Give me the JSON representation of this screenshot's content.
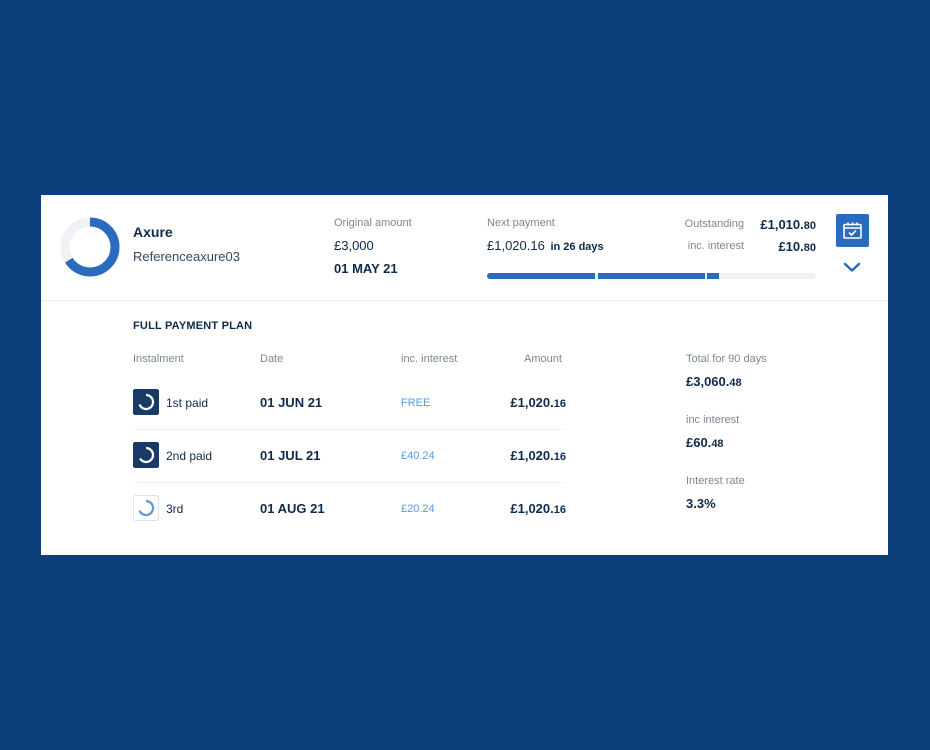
{
  "merchant": {
    "name": "Axure",
    "reference": "Referenceaxure03",
    "progress_fraction": 0.66
  },
  "original": {
    "label": "Original amount",
    "amount": "£3,000",
    "date": "01 MAY 21"
  },
  "next_payment": {
    "label": "Next payment",
    "amount": "£1,020.16",
    "due_in": "in 26 days",
    "paid_instalments": 2,
    "total_instalments": 3
  },
  "outstanding": {
    "label": "Outstanding",
    "amount_main": "£1,010.",
    "amount_cents": "80",
    "interest_label": "inc. interest",
    "interest_main": "£10.",
    "interest_cents": "80"
  },
  "actions": {
    "calendar_icon": "calendar-check-icon",
    "expand_icon": "chevron-down-icon"
  },
  "plan": {
    "title": "FULL PAYMENT PLAN",
    "headers": {
      "instalment": "Instalment",
      "date": "Date",
      "interest": "inc. interest",
      "amount": "Amount"
    },
    "rows": [
      {
        "label": "1st paid",
        "date": "01 JUN 21",
        "interest": "FREE",
        "amount_main": "£1,020.",
        "amount_cents": "16",
        "status": "paid"
      },
      {
        "label": "2nd paid",
        "date": "01 JUL 21",
        "interest": "£40.24",
        "amount_main": "£1,020.",
        "amount_cents": "16",
        "status": "paid"
      },
      {
        "label": "3rd",
        "date": "01 AUG 21",
        "interest": "£20.24",
        "amount_main": "£1,020.",
        "amount_cents": "16",
        "status": "upcoming"
      }
    ]
  },
  "summary": {
    "total_label": "Total for 90 days",
    "total_main": "£3,060.",
    "total_cents": "48",
    "interest_label": "inc interest",
    "interest_main": "£60.",
    "interest_cents": "48",
    "rate_label": "Interest rate",
    "rate_value": "3.3%"
  },
  "colors": {
    "background": "#0d3f7c",
    "accent": "#2a6bc0",
    "dark": "#1a3a66",
    "interest_text": "#5a9ad8"
  }
}
